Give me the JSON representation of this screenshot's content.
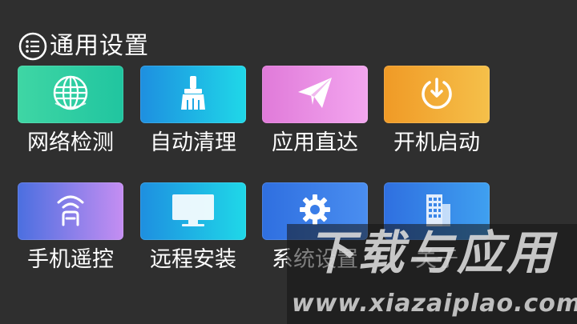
{
  "header": {
    "title": "通用设置",
    "icon": "list-menu-icon"
  },
  "tiles": [
    {
      "label": "网络检测",
      "icon": "globe-icon",
      "colors": [
        "#3fd6a4",
        "#20c5a0"
      ]
    },
    {
      "label": "自动清理",
      "icon": "broom-icon",
      "colors": [
        "#1e8fe0",
        "#1fd8e8"
      ]
    },
    {
      "label": "应用直达",
      "icon": "paper-plane-icon",
      "colors": [
        "#e07ad9",
        "#f3a6ef"
      ]
    },
    {
      "label": "开机启动",
      "icon": "power-icon",
      "colors": [
        "#f09a26",
        "#f5c04a"
      ]
    },
    {
      "label": "手机遥控",
      "icon": "remote-signal-icon",
      "colors": [
        "#4b6fe0",
        "#c58ef2"
      ]
    },
    {
      "label": "远程安装",
      "icon": "monitor-icon",
      "colors": [
        "#1e8fe0",
        "#1fd8e8"
      ]
    },
    {
      "label": "系统设置",
      "icon": "gear-icon",
      "colors": [
        "#2f6fe0",
        "#4a8ef0"
      ]
    },
    {
      "label": "关于",
      "icon": "building-icon",
      "colors": [
        "#2f6fe0",
        "#3fa0f0"
      ]
    }
  ],
  "watermark": {
    "brand": "下载与应用",
    "url": "www.xiazaiplao.com"
  }
}
